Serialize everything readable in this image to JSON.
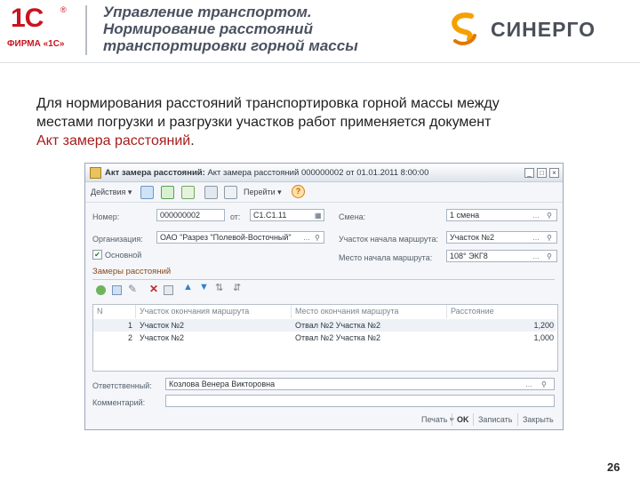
{
  "logo_1c": {
    "mark": "1С",
    "registered": "®",
    "caption": "ФИРМА «1С»"
  },
  "slide": {
    "title_lines": [
      "Управление транспортом.",
      "Нормирование расстояний",
      "транспортировки горной массы"
    ],
    "brand": "СИНЕРГО",
    "intro_line1": "Для нормирования расстояний транспортировка горной массы между",
    "intro_line2a": "местами погрузки и разгрузки участков работ применяется документ",
    "intro_highlight": "Акт замера расстояний",
    "intro_end": ".",
    "page_number": "26"
  },
  "window": {
    "title_bold": "Акт замера расстояний:",
    "title_rest": " Акт замера расстояний 000000002 от 01.01.2011 8:00:00",
    "controls": [
      "_",
      "□",
      "×"
    ],
    "toolbar": {
      "actions": "Действия ▾",
      "goto": "Перейти ▾",
      "help": "?"
    },
    "form": {
      "number_label": "Номер:",
      "number_value": "000000002",
      "from_label": "от:",
      "date_value": "С1.С1.11",
      "shift_label": "Смена:",
      "shift_value": "1 смена",
      "org_label": "Организация:",
      "org_value": "ОАО \"Разрез \"Полевой-Восточный\"",
      "route_start_section_label": "Участок начала маршрута:",
      "route_start_section_value": "Участок №2",
      "main_checkbox_label": "Основной",
      "route_start_place_label": "Место начала маршрута:",
      "route_start_place_value": "108° ЭКГ8"
    },
    "section_title": "Замеры расстояний",
    "table": {
      "headers": [
        "N",
        "Участок окончания маршрута",
        "Место окончания маршрута",
        "Расстояние"
      ],
      "rows": [
        [
          "1",
          "Участок №2",
          "Отвал №2 Участка №2",
          "1,200"
        ],
        [
          "2",
          "Участок №2",
          "Отвал №2 Участка №2",
          "1,000"
        ]
      ]
    },
    "responsible_label": "Ответственный:",
    "responsible_value": "Козлова Венера Викторовна",
    "comment_label": "Комментарий:",
    "footer": {
      "print": "Печать ▾",
      "ok": "OK",
      "save": "Записать",
      "close": "Закрыть"
    }
  },
  "colors": {
    "accent_red": "#c8141e",
    "title_gray": "#4a5160",
    "link_red": "#a61c1c",
    "brand_orange": "#f5a000"
  }
}
